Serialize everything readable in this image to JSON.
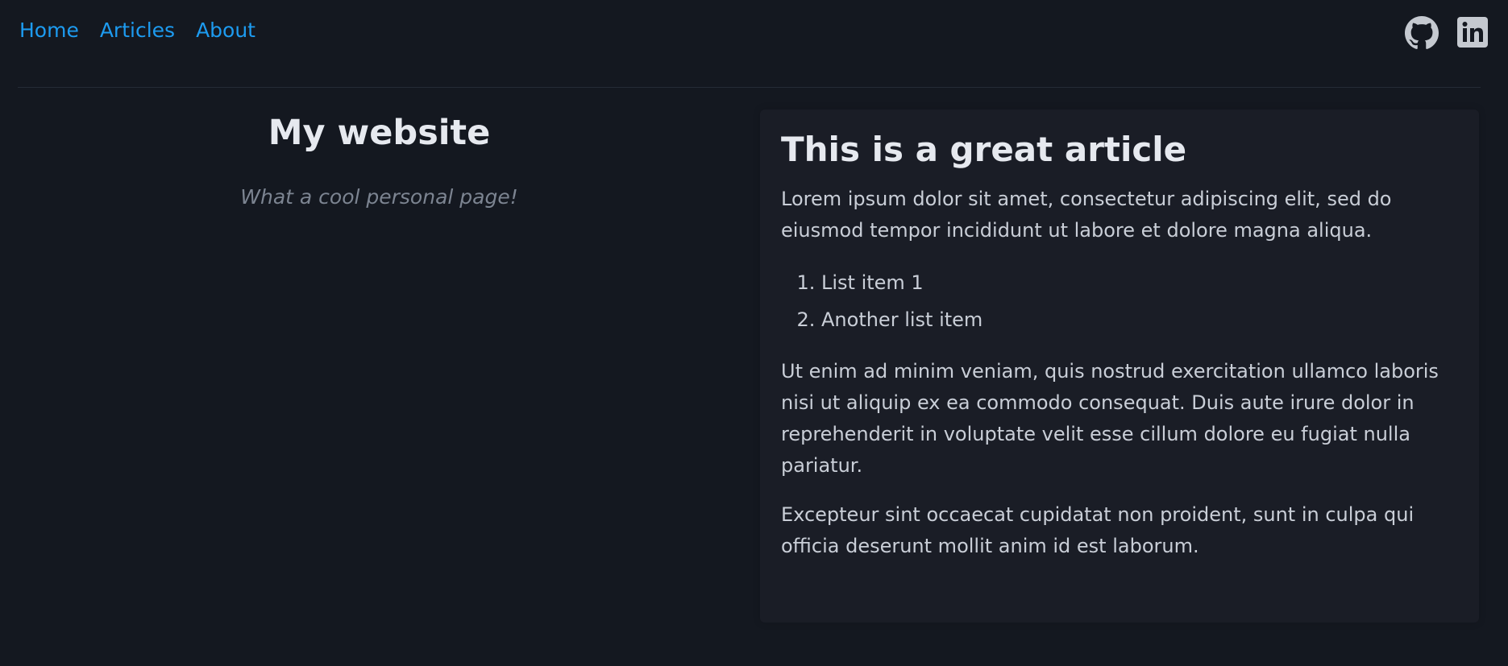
{
  "nav": {
    "items": [
      {
        "label": "Home"
      },
      {
        "label": "Articles"
      },
      {
        "label": "About"
      }
    ],
    "social": [
      {
        "icon": "github-icon"
      },
      {
        "icon": "linkedin-icon"
      }
    ]
  },
  "hero": {
    "title": "My website",
    "tagline": "What a cool personal page!"
  },
  "article": {
    "title": "This is a great article",
    "paragraph_1": "Lorem ipsum dolor sit amet, consectetur adipiscing elit, sed do eiusmod tempor incididunt ut labore et dolore magna aliqua.",
    "list": [
      "List item 1",
      "Another list item"
    ],
    "paragraph_2": "Ut enim ad minim veniam, quis nostrud exercitation ullamco laboris nisi ut aliquip ex ea commodo consequat. Duis aute irure dolor in reprehenderit in voluptate velit esse cillum dolore eu fugiat nulla pariatur.",
    "paragraph_3": "Excepteur sint occaecat cupidatat non proident, sunt in culpa qui officia deserunt mollit anim id est laborum."
  },
  "colors": {
    "background": "#141820",
    "card": "#1a1d26",
    "link": "#1d9bf0",
    "heading": "#e6e9ef",
    "text": "#c9ced7",
    "muted": "#7c8491"
  }
}
